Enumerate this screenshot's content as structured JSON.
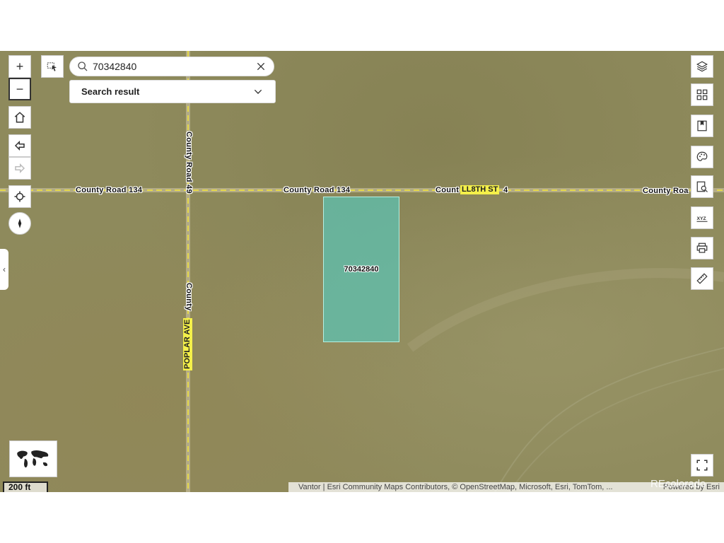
{
  "search": {
    "value": "70342840",
    "result_label": "Search result"
  },
  "map": {
    "roads": {
      "horizontal_label_1": "County Road 134",
      "horizontal_label_2": "County Road 134",
      "horizontal_label_3_prefix": "Count",
      "horizontal_label_3_suffix": "4",
      "horizontal_label_4": "County Roa",
      "vertical_label_top": "County Road 49",
      "vertical_label_mid": "County",
      "street_tag_h": "LL8TH ST",
      "street_tag_v": "POPLAR AVE"
    },
    "parcel": {
      "id": "70342840",
      "fill_color": "#5cc4b4"
    }
  },
  "scale": {
    "label": "200 ft"
  },
  "attribution": {
    "credits": "Vantor | Esri Community Maps Contributors, © OpenStreetMap, Microsoft, Esri, TomTom, ...",
    "powered": "Powered by Esri"
  },
  "watermark": "REcolorado",
  "controls": {
    "zoom_in": "+",
    "zoom_out": "−",
    "collapse": "‹"
  }
}
